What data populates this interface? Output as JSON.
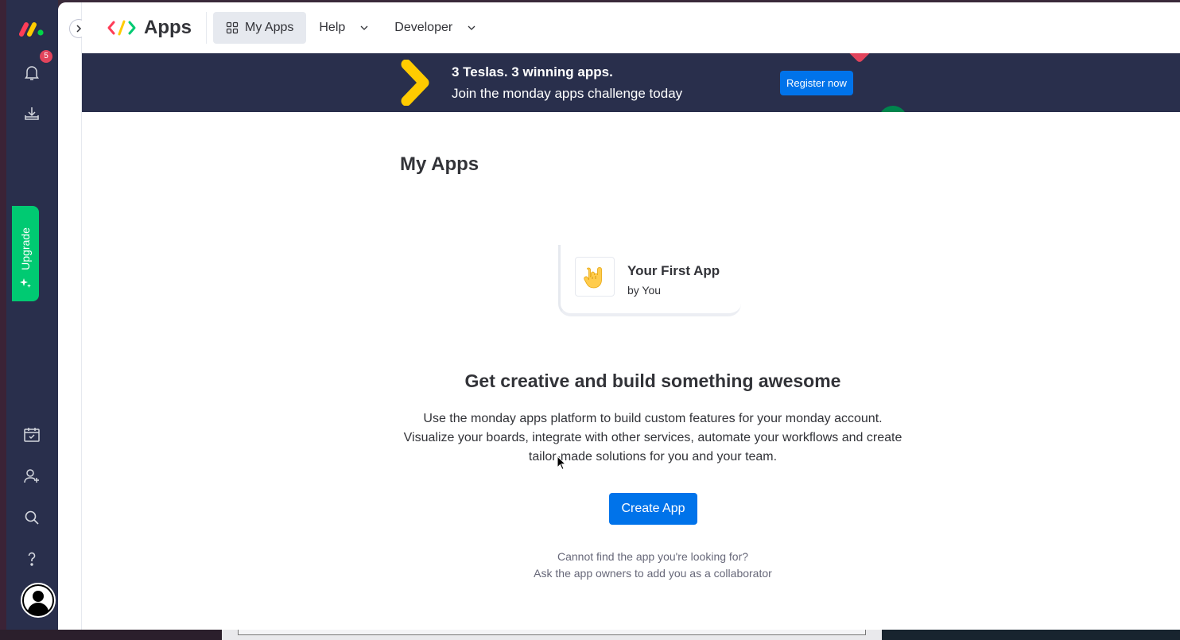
{
  "rail": {
    "notification_count": "5",
    "upgrade_label": "Upgrade",
    "icons": [
      "monday-logo-icon",
      "bell-icon",
      "download-icon",
      "calendar-check-icon",
      "add-user-icon",
      "search-icon",
      "help-icon",
      "avatar-icon"
    ]
  },
  "header": {
    "title": "Apps",
    "nav": [
      {
        "label": "My Apps",
        "icon": "grid-icon",
        "active": true
      },
      {
        "label": "Help",
        "icon": "chevron-down-icon"
      },
      {
        "label": "Developer",
        "icon": "chevron-down-icon"
      }
    ]
  },
  "banner": {
    "line1": "3 Teslas. 3 winning apps.",
    "line2": "Join the monday apps challenge today",
    "button": "Register now"
  },
  "main": {
    "page_title": "My Apps",
    "sample_app": {
      "name": "Your First App",
      "by": "by You",
      "icon": "rock-hand-emoji-icon"
    },
    "headline": "Get creative and build something awesome",
    "description": "Use the monday apps platform to build custom features for your monday account. Visualize your boards, integrate with other services, automate your workflows and create tailor-made solutions for you and your team.",
    "create_button": "Create App",
    "hint_line1": "Cannot find the app you're looking for?",
    "hint_line2": "Ask the app owners to add you as a collaborator"
  },
  "colors": {
    "rail_bg": "#292f4c",
    "primary": "#0073ea",
    "upgrade": "#00ca72",
    "badge": "#e2445c"
  }
}
